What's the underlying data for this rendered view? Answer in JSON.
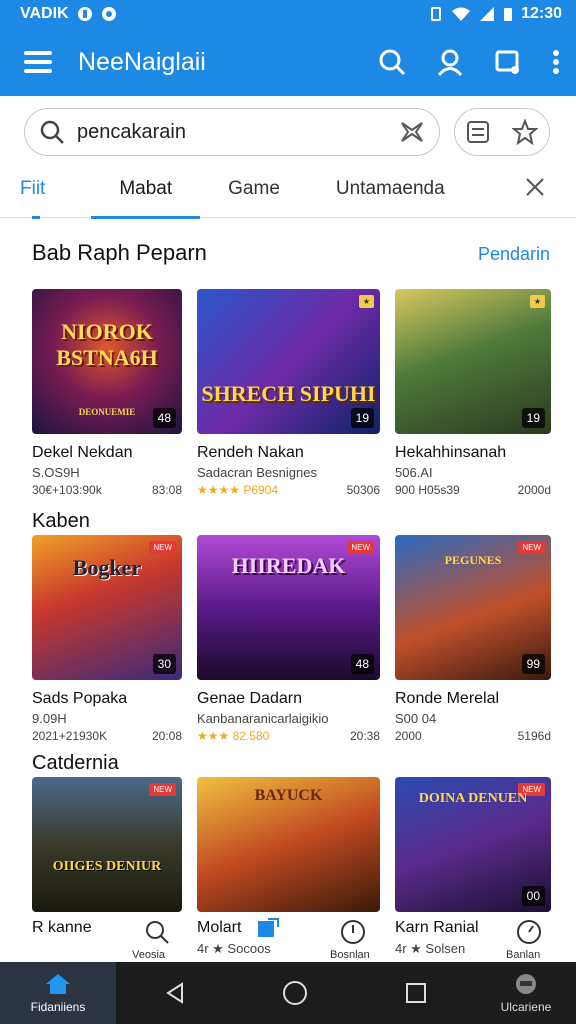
{
  "status": {
    "left_text": "VADIK",
    "time": "12:30"
  },
  "appbar": {
    "title": "NeeNaiglaii"
  },
  "search": {
    "value": "pencakarain"
  },
  "tabs": [
    "Fiit",
    "Mabat",
    "Game",
    "Untamaenda"
  ],
  "sections": [
    {
      "title": "Bab Raph Peparn",
      "see_all": "Pendarin",
      "cards": [
        {
          "art": "NIOROK BSTNA6H",
          "art_sub": "DEONUEMIE",
          "badge": "48",
          "name": "Dekel Nekdan",
          "sub": "S.OS9H",
          "meta_left": "30€+103:90k",
          "meta_right": "83:08"
        },
        {
          "art": "SHRECH SIPUHI",
          "badge": "19",
          "name": "Rendeh Nakan",
          "sub": "Sadacran Besnignes",
          "meta_left": "★★★★ P6904",
          "meta_right": "50306"
        },
        {
          "art": "",
          "badge": "19",
          "name": "Hekahhinsanah",
          "sub": "506.AI",
          "meta_left": "900 H05s39",
          "meta_right": "2000d"
        }
      ]
    },
    {
      "title": "Kaben",
      "cards": [
        {
          "art": "Bogker",
          "badge": "30",
          "name": "Sads Popaka",
          "sub": "9.09H",
          "meta_left": "2021+21930K",
          "meta_right": "20:08"
        },
        {
          "art": "HIIREDAK",
          "badge": "48",
          "name": "Genae Dadarn",
          "sub": "Kanbanaranicarlaigikio",
          "meta_left": "★★★ 82.580",
          "meta_right": "20:38"
        },
        {
          "art": "PEGUNES",
          "badge": "99",
          "name": "Ronde Merelal",
          "sub": "S00 04",
          "meta_left": "2000",
          "meta_right": "5196d"
        }
      ]
    },
    {
      "title": "Catdernia",
      "cards": [
        {
          "art": "OIIGES DENIUR",
          "badge": "",
          "name": "R kanne",
          "sub": "",
          "meta_left": "",
          "meta_right": ""
        },
        {
          "art": "BAYUCK",
          "badge": "",
          "name": "Molart",
          "sub": "4r ★ Socoos",
          "meta_left": "",
          "meta_right": ""
        },
        {
          "art": "DOINA DENUEN",
          "badge": "00",
          "name": "Karn Ranial",
          "sub": "4r ★ Solsen",
          "meta_left": "",
          "meta_right": ""
        }
      ]
    }
  ],
  "bottom_labels": {
    "search": "Veosia",
    "bug": "Bosnlan",
    "clock": "Banlan"
  },
  "navbar": {
    "home_label": "Fidaniiens",
    "right_label": "Ulcariene"
  },
  "colors": {
    "accent": "#1e88e5",
    "nav": "#1c1c1c"
  }
}
